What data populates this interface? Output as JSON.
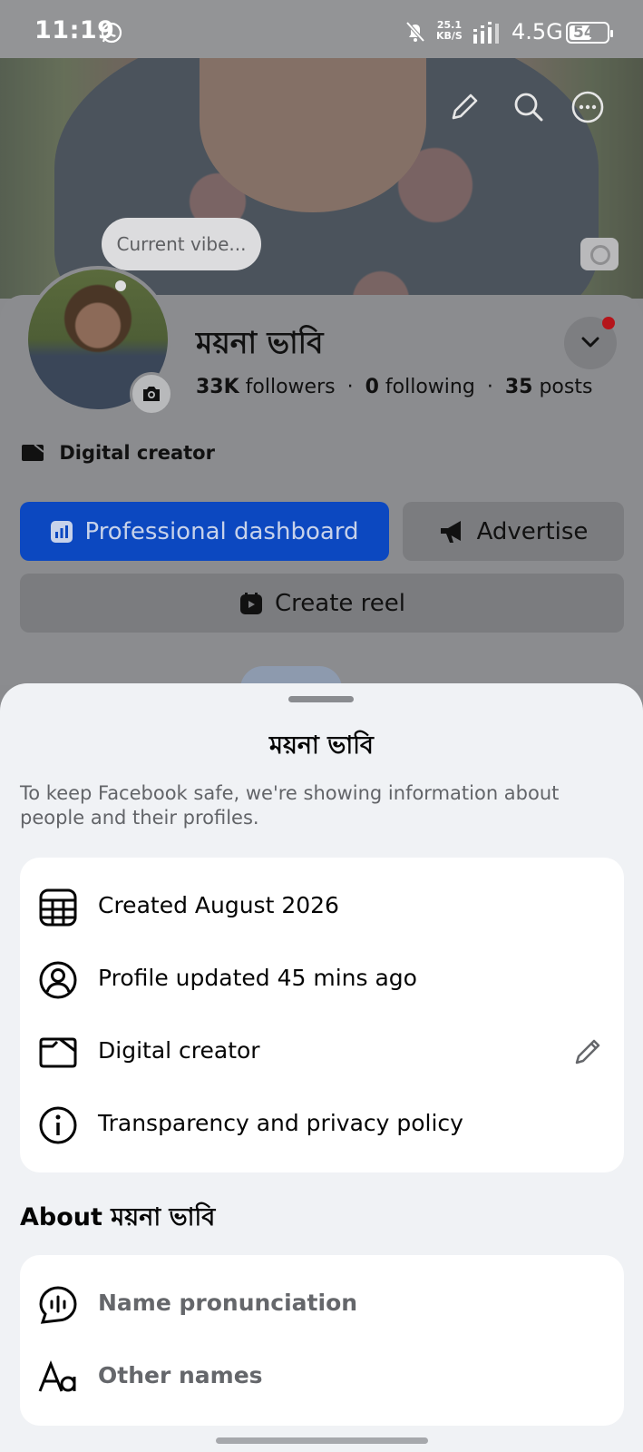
{
  "status_bar": {
    "time": "11:19",
    "speed_value": "25.1",
    "speed_unit": "KB/S",
    "network": "4.5G",
    "battery": "54"
  },
  "profile": {
    "vibe_placeholder": "Current vibe...",
    "name": "ময়না ভাবি",
    "followers_count": "33K",
    "followers_label": "followers",
    "following_count": "0",
    "following_label": "following",
    "posts_count": "35",
    "posts_label": "posts",
    "category": "Digital creator",
    "buttons": {
      "dashboard": "Professional dashboard",
      "advertise": "Advertise",
      "create_reel": "Create reel"
    }
  },
  "sheet": {
    "title": "ময়না ভাবি",
    "description": "To keep Facebook safe, we're showing information about people and their profiles.",
    "info_rows": [
      {
        "icon": "calendar-icon",
        "text": "Created August 2026"
      },
      {
        "icon": "profile-icon",
        "text": "Profile updated 45 mins ago"
      },
      {
        "icon": "folder-icon",
        "text": "Digital creator"
      },
      {
        "icon": "info-icon",
        "text": "Transparency and privacy policy"
      }
    ],
    "about_title": "About ময়না ভাবি",
    "about_rows": [
      {
        "icon": "pronunciation-icon",
        "text": "Name pronunciation"
      },
      {
        "icon": "text-aa-icon",
        "text": "Other names"
      }
    ]
  },
  "colors": {
    "primary_blue": "#0c48c0",
    "notification_red": "#b5151b",
    "sheet_bg": "#f0f2f5"
  }
}
